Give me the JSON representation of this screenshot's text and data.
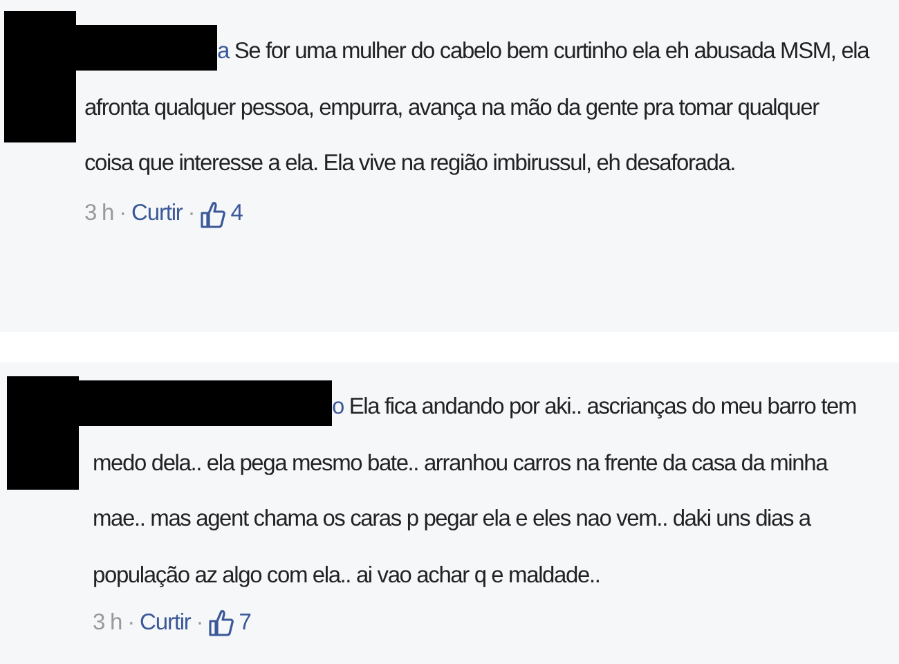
{
  "comments": [
    {
      "author": "a",
      "text": "Se for uma mulher do cabelo bem curtinho ela eh abusada MSM, ela afronta qualquer pessoa, empurra, avança na mão da gente pra tomar qualquer coisa que interesse a ela. Ela vive na região imbirussul, eh desaforada.",
      "time": "3 h",
      "separator": "·",
      "like_label": "Curtir",
      "likes_separator": "·",
      "likes": "4"
    },
    {
      "author": "o",
      "text": "Ela fica andando por aki.. ascrianças do meu barro tem medo dela.. ela pega mesmo bate.. arranhou carros na frente da casa da minha mae.. mas agent chama os caras p pegar ela e eles nao vem.. daki uns dias a população az algo com ela.. ai vao achar q e maldade..",
      "time": "3 h",
      "separator": "·",
      "like_label": "Curtir",
      "likes_separator": "·",
      "likes": "7"
    }
  ]
}
